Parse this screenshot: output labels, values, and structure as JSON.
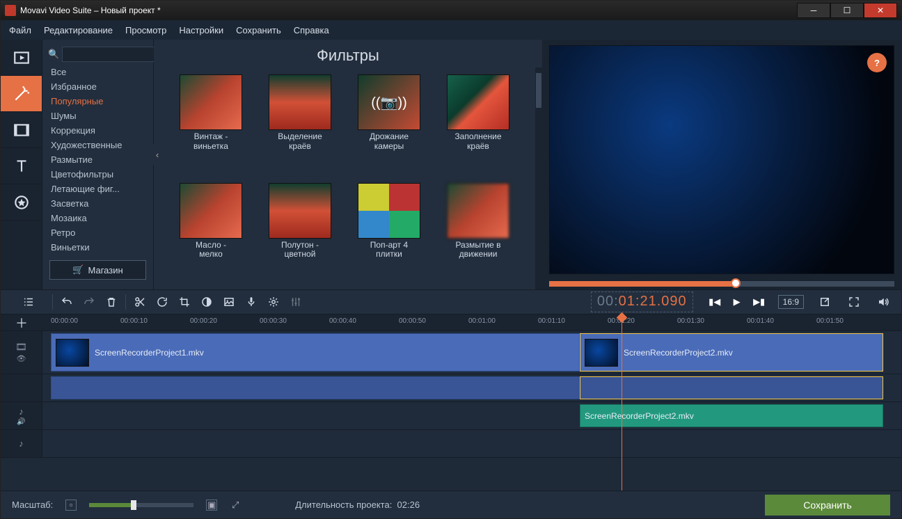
{
  "window": {
    "title": "Movavi Video Suite – Новый проект *"
  },
  "menu": {
    "file": "Файл",
    "edit": "Редактирование",
    "view": "Просмотр",
    "settings": "Настройки",
    "save": "Сохранить",
    "help": "Справка"
  },
  "sidebar_tabs": {
    "media": "media",
    "filters": "filters",
    "transitions": "transitions",
    "titles": "titles",
    "stickers": "stickers"
  },
  "categories": {
    "search_placeholder": "",
    "items": [
      {
        "label": "Все",
        "active": false
      },
      {
        "label": "Избранное",
        "active": false
      },
      {
        "label": "Популярные",
        "active": true
      },
      {
        "label": "Шумы",
        "active": false
      },
      {
        "label": "Коррекция",
        "active": false
      },
      {
        "label": "Художественные",
        "active": false
      },
      {
        "label": "Размытие",
        "active": false
      },
      {
        "label": "Цветофильтры",
        "active": false
      },
      {
        "label": "Летающие фиг...",
        "active": false
      },
      {
        "label": "Засветка",
        "active": false
      },
      {
        "label": "Мозаика",
        "active": false
      },
      {
        "label": "Ретро",
        "active": false
      },
      {
        "label": "Виньетки",
        "active": false
      }
    ],
    "store_label": "Магазин"
  },
  "filters": {
    "title": "Фильтры",
    "items": [
      {
        "name": "Винтаж -\nвиньетка"
      },
      {
        "name": "Выделение\nкраёв"
      },
      {
        "name": "Дрожание\nкамеры"
      },
      {
        "name": "Заполнение\nкраёв"
      },
      {
        "name": "Масло -\nмелко"
      },
      {
        "name": "Полутон -\nцветной"
      },
      {
        "name": "Поп-арт 4\nплитки"
      },
      {
        "name": "Размытие в\nдвижении"
      }
    ]
  },
  "preview": {
    "timecode_gray": "00:",
    "timecode_orange": "01:21.090",
    "aspect": "16:9",
    "progress_pct": 54
  },
  "ruler": {
    "ticks": [
      "00:00:00",
      "00:00:10",
      "00:00:20",
      "00:00:30",
      "00:00:40",
      "00:00:50",
      "00:01:00",
      "00:01:10",
      "00:01:20",
      "00:01:30",
      "00:01:40",
      "00:01:50"
    ],
    "playhead_label": "00:01:20"
  },
  "timeline": {
    "clip1_label": "ScreenRecorderProject1.mkv",
    "clip2_label": "ScreenRecorderProject2.mkv",
    "audio2_label": "ScreenRecorderProject2.mkv"
  },
  "bottom": {
    "zoom_label": "Масштаб:",
    "duration_label": "Длительность проекта:",
    "duration_value": "02:26",
    "save_label": "Сохранить"
  }
}
